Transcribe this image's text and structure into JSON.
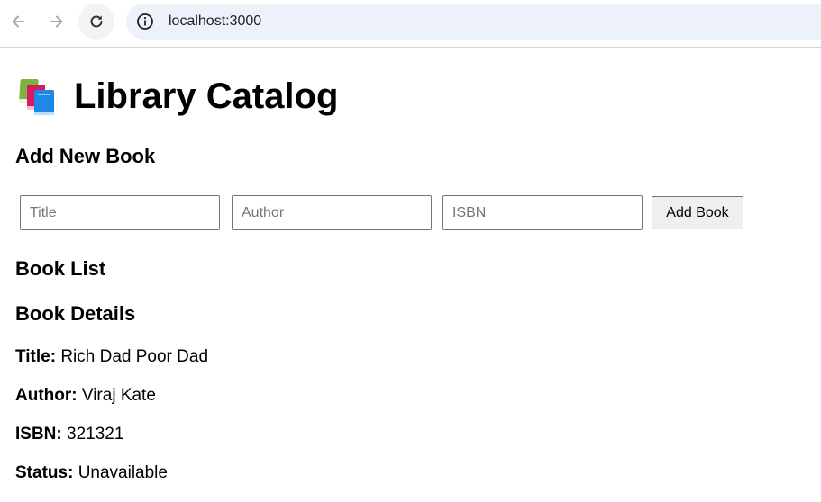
{
  "browser": {
    "url": "localhost:3000"
  },
  "page": {
    "title": "Library Catalog",
    "title_emoji": "books-emoji-icon"
  },
  "add_section": {
    "heading": "Add New Book",
    "title_placeholder": "Title",
    "author_placeholder": "Author",
    "isbn_placeholder": "ISBN",
    "title_value": "",
    "author_value": "",
    "isbn_value": "",
    "add_button_label": "Add Book"
  },
  "list_section": {
    "heading": "Book List"
  },
  "details_section": {
    "heading": "Book Details",
    "fields": [
      {
        "label": "Title:",
        "value": "Rich Dad Poor Dad"
      },
      {
        "label": "Author:",
        "value": "Viraj Kate"
      },
      {
        "label": "ISBN:",
        "value": "321321"
      },
      {
        "label": "Status:",
        "value": "Unavailable"
      }
    ]
  }
}
